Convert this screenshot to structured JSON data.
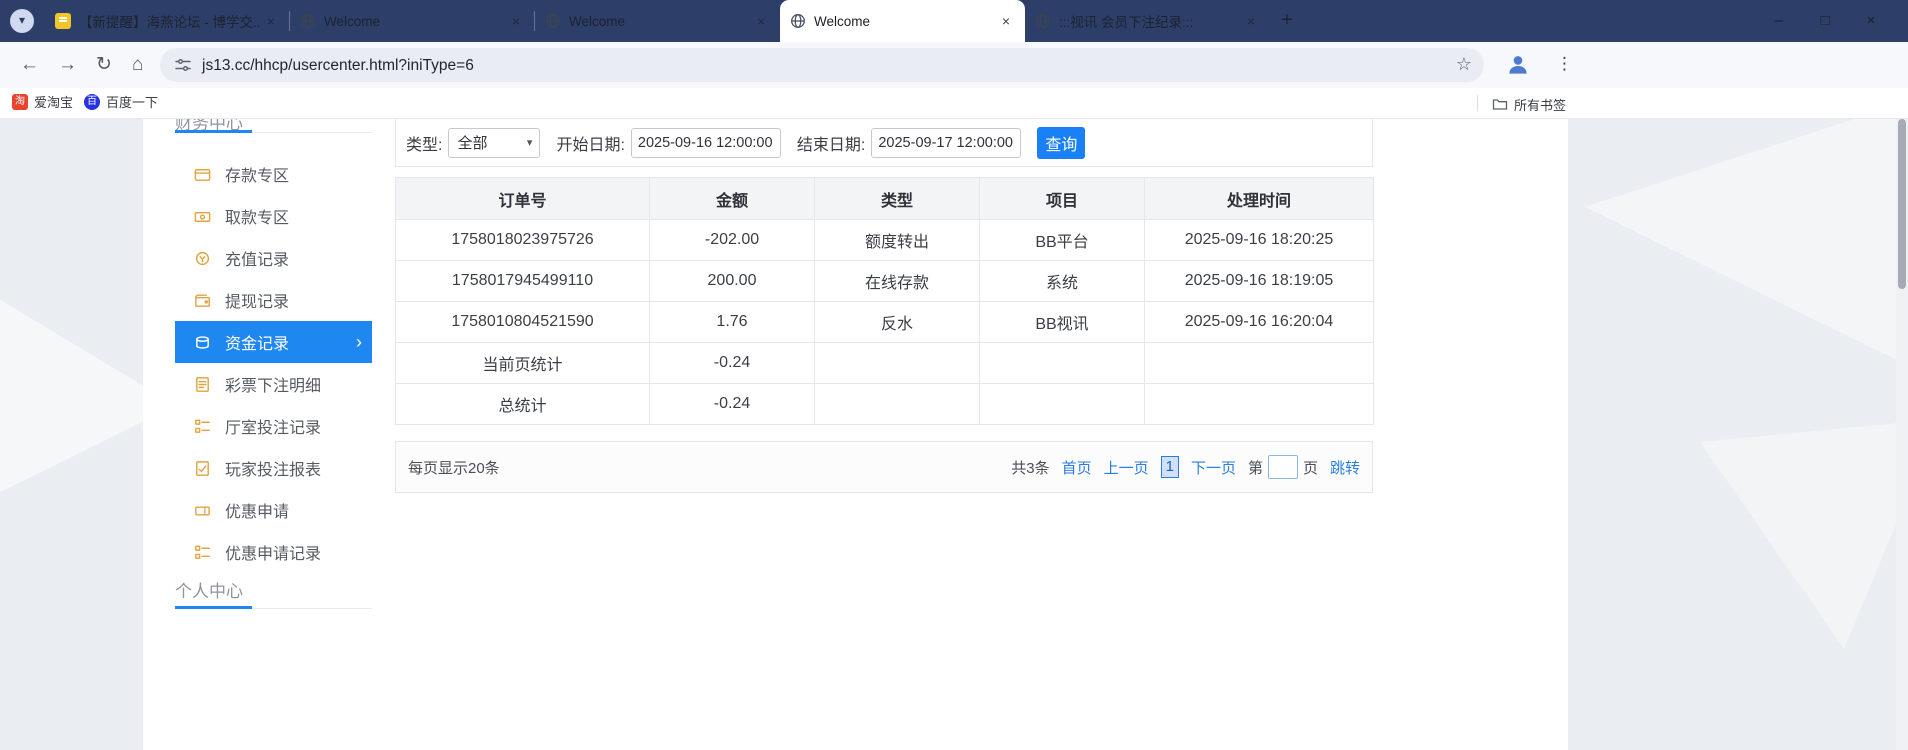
{
  "browser": {
    "tabs": [
      {
        "label": "【新提醒】海燕论坛 - 博学交...",
        "active": false
      },
      {
        "label": "Welcome",
        "active": false
      },
      {
        "label": "Welcome",
        "active": false
      },
      {
        "label": "Welcome",
        "active": true
      },
      {
        "label": ":::视讯 会员下注纪录:::",
        "active": false
      }
    ],
    "url": "js13.cc/hhcp/usercenter.html?iniType=6",
    "bookmarks": [
      {
        "label": "爱淘宝"
      },
      {
        "label": "百度一下"
      }
    ],
    "bookmarks_right_label": "所有书签"
  },
  "icons": {
    "close": "×",
    "plus": "+",
    "back": "←",
    "forward": "→",
    "reload": "↻",
    "home": "⌂",
    "star": "☆",
    "menu_dots": "⋮",
    "minimize": "–",
    "maximize": "□",
    "window_close": "×",
    "chevron_right": "›",
    "chevron_down": "▾",
    "tab_search": "▾",
    "taobao_glyph": "淘",
    "baidu_glyph": "百"
  },
  "sidebar": {
    "section1": "财务中心",
    "items": [
      {
        "label": "存款专区",
        "active": false
      },
      {
        "label": "取款专区",
        "active": false
      },
      {
        "label": "充值记录",
        "active": false
      },
      {
        "label": "提现记录",
        "active": false
      },
      {
        "label": "资金记录",
        "active": true
      },
      {
        "label": "彩票下注明细",
        "active": false
      },
      {
        "label": "厅室投注记录",
        "active": false
      },
      {
        "label": "玩家投注报表",
        "active": false
      },
      {
        "label": "优惠申请",
        "active": false
      },
      {
        "label": "优惠申请记录",
        "active": false
      }
    ],
    "section2": "个人中心"
  },
  "filters": {
    "type_label": "类型:",
    "type_value": "全部",
    "start_label": "开始日期:",
    "start_value": "2025-09-16 12:00:00",
    "end_label": "结束日期:",
    "end_value": "2025-09-17 12:00:00",
    "query_button": "查询"
  },
  "table": {
    "headers": [
      "订单号",
      "金额",
      "类型",
      "项目",
      "处理时间"
    ],
    "rows": [
      [
        "1758018023975726",
        "-202.00",
        "额度转出",
        "BB平台",
        "2025-09-16 18:20:25"
      ],
      [
        "1758017945499110",
        "200.00",
        "在线存款",
        "系统",
        "2025-09-16 18:19:05"
      ],
      [
        "1758010804521590",
        "1.76",
        "反水",
        "BB视讯",
        "2025-09-16 16:20:04"
      ],
      [
        "当前页统计",
        "-0.24",
        "",
        "",
        ""
      ],
      [
        "总统计",
        "-0.24",
        "",
        "",
        ""
      ]
    ]
  },
  "pagination": {
    "per_page": "每页显示20条",
    "total": "共3条",
    "first": "首页",
    "prev": "上一页",
    "current": "1",
    "next": "下一页",
    "page_pre": "第",
    "page_input_value": "",
    "page_post": "页",
    "jump": "跳转"
  },
  "colors": {
    "titlebar": "#2d3f69",
    "sidebar_active": "#1f87f0",
    "button_blue": "#1a80f5",
    "link_blue": "#2a7de1",
    "sidebar_icon_orange": "#e2a33e"
  }
}
